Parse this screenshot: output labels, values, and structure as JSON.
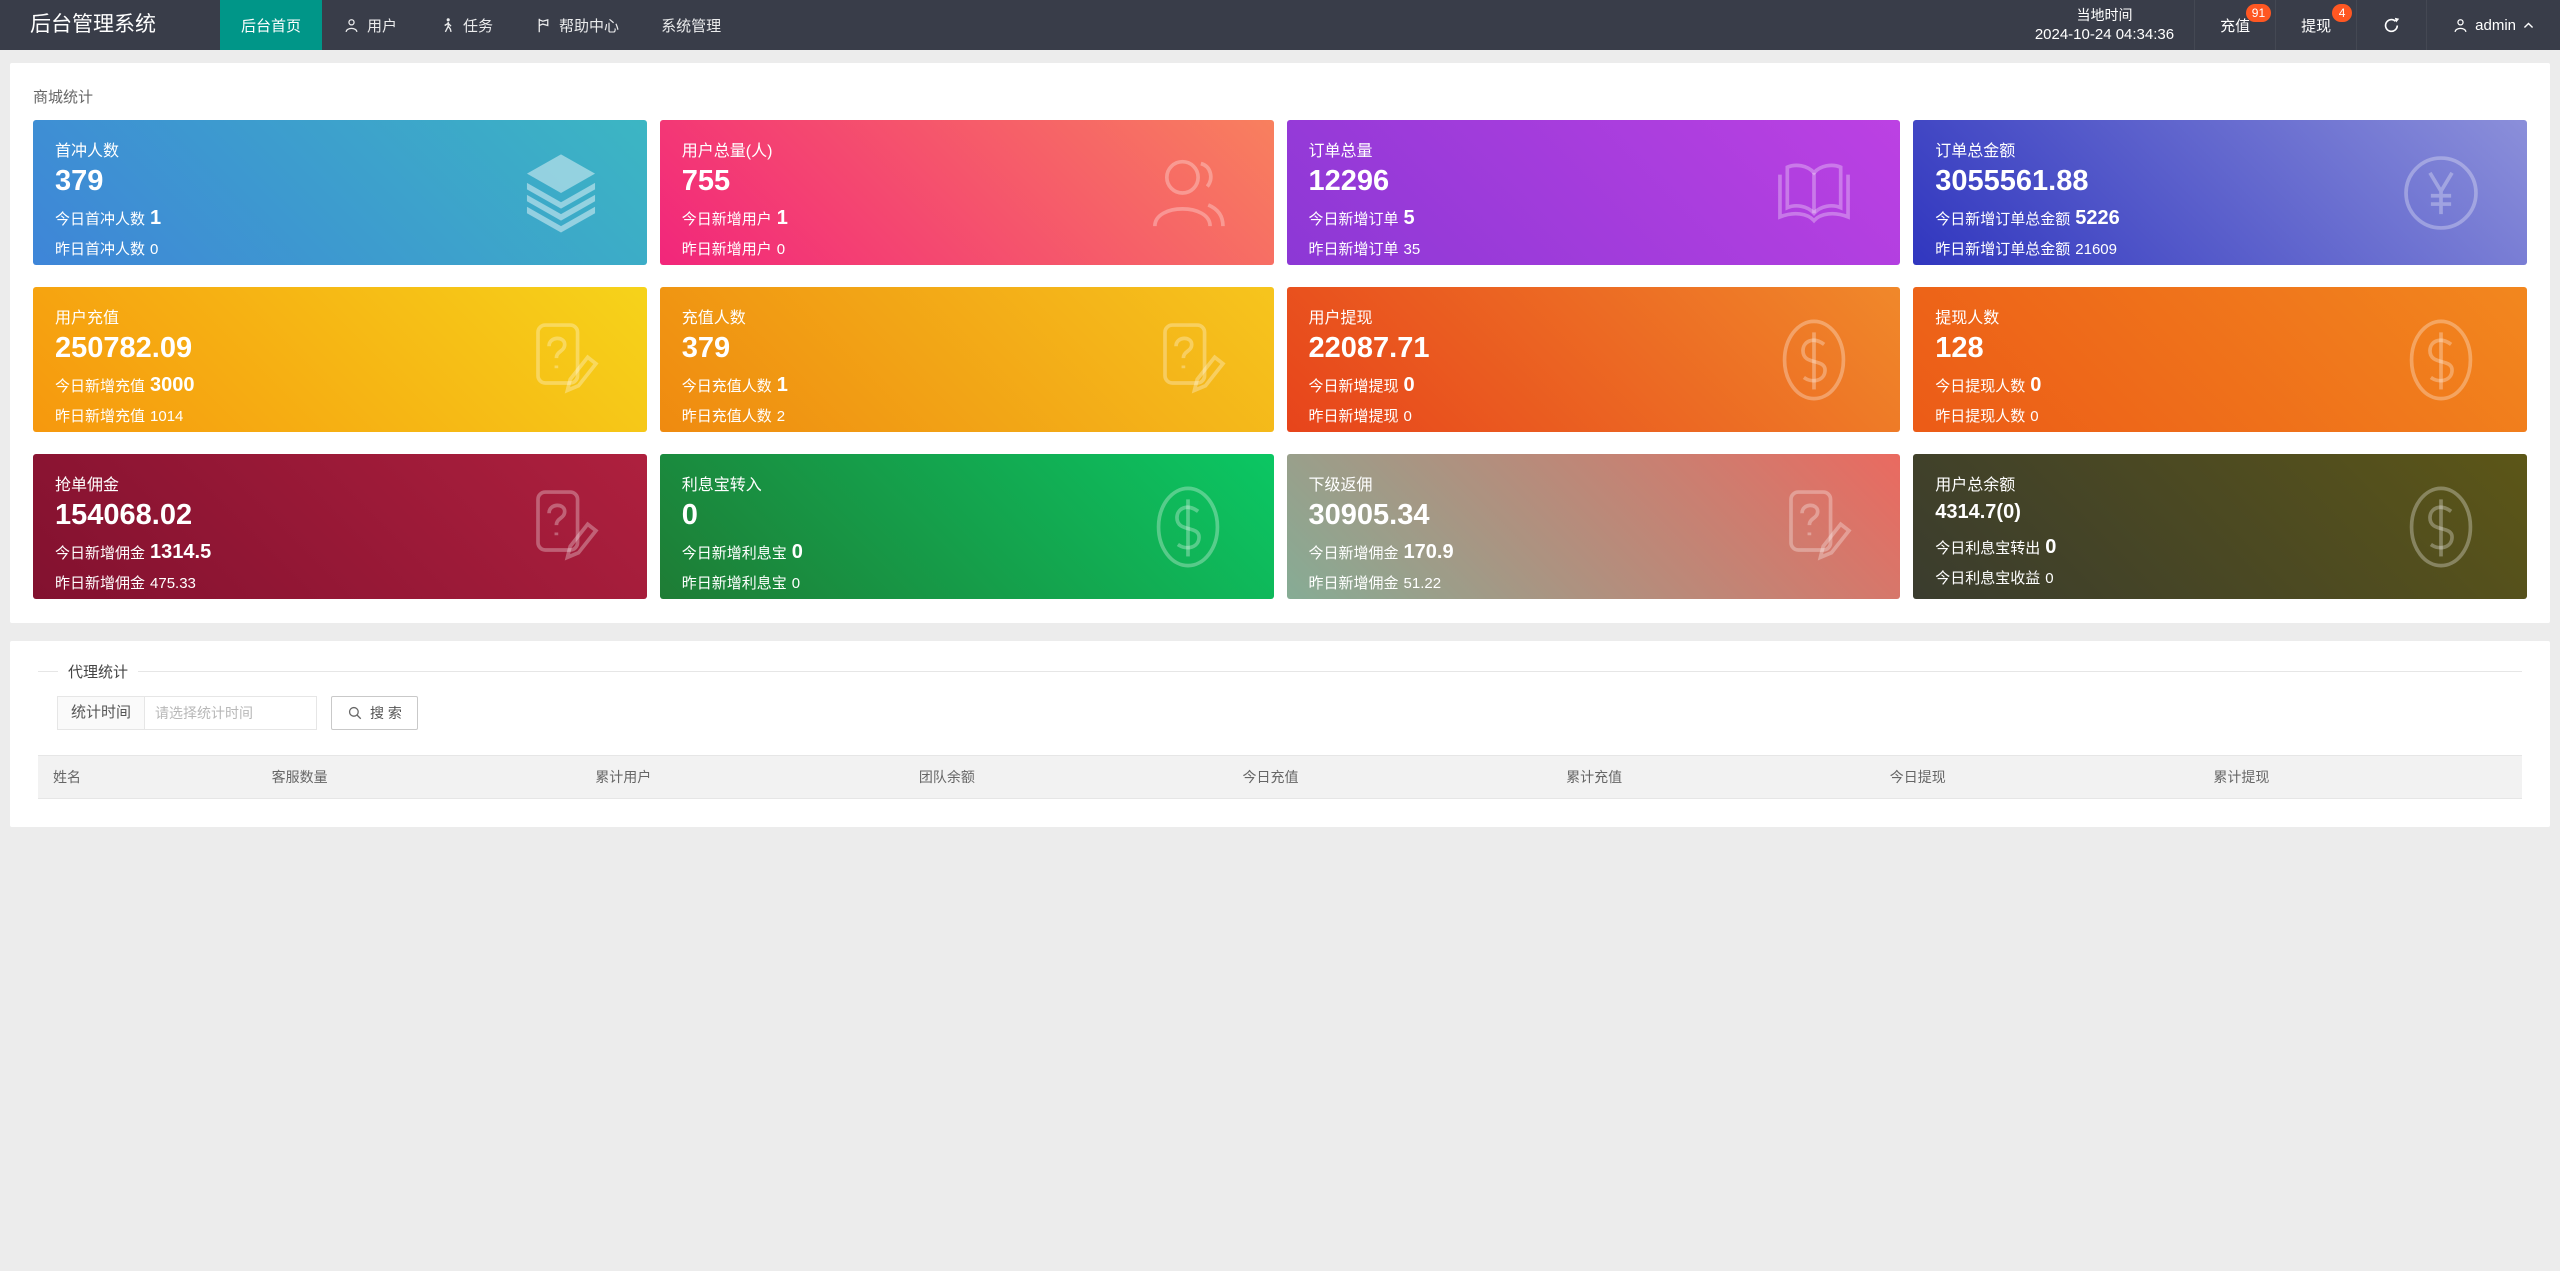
{
  "navbar": {
    "brand": "后台管理系统",
    "bar_color": "#393D49",
    "active_item_color": "#009688",
    "badge_color": "#FF5722",
    "items": [
      {
        "label": "后台首页",
        "active": true
      },
      {
        "label": "用户"
      },
      {
        "label": "任务"
      },
      {
        "label": "帮助中心"
      },
      {
        "label": "系统管理"
      }
    ],
    "local_time_label": "当地时间",
    "local_time_value": "2024-10-24 04:34:36",
    "recharge": {
      "label": "充值",
      "badge": "91"
    },
    "withdraw": {
      "label": "提现",
      "badge": "4"
    },
    "username": "admin"
  },
  "mall_stats": {
    "title": "商城统计",
    "cards": [
      {
        "title": "首冲人数",
        "value": "379",
        "today_label": "今日首冲人数",
        "today_value": "1",
        "yesterday_label": "昨日首冲人数",
        "yesterday_value": "0",
        "icon": "layers",
        "gradient": [
          "#3E85D8",
          "#3CB6C3"
        ]
      },
      {
        "title": "用户总量(人)",
        "value": "755",
        "today_label": "今日新增用户",
        "today_value": "1",
        "yesterday_label": "昨日新增用户",
        "yesterday_value": "0",
        "icon": "users",
        "gradient": [
          "#F2267B",
          "#F8805E"
        ]
      },
      {
        "title": "订单总量",
        "value": "12296",
        "today_label": "今日新增订单",
        "today_value": "5",
        "yesterday_label": "昨日新增订单",
        "yesterday_value": "35",
        "icon": "open-book",
        "gradient": [
          "#8C38D5",
          "#BC41E3"
        ]
      },
      {
        "title": "订单总金额",
        "value": "3055561.88",
        "today_label": "今日新增订单总金额",
        "today_value": "5226",
        "yesterday_label": "昨日新增订单总金额",
        "yesterday_value": "21609",
        "icon": "yen-circle",
        "gradient": [
          "#3036BF",
          "#8B8FDA"
        ]
      },
      {
        "title": "用户充值",
        "value": "250782.09",
        "today_label": "今日新增充值",
        "today_value": "3000",
        "yesterday_label": "昨日新增充值",
        "yesterday_value": "1014",
        "icon": "document-question",
        "gradient": [
          "#F6980E",
          "#F6D31A"
        ]
      },
      {
        "title": "充值人数",
        "value": "379",
        "today_label": "今日充值人数",
        "today_value": "1",
        "yesterday_label": "昨日充值人数",
        "yesterday_value": "2",
        "icon": "document-question",
        "gradient": [
          "#EF8A10",
          "#F6C51D"
        ]
      },
      {
        "title": "用户提现",
        "value": "22087.71",
        "today_label": "今日新增提现",
        "today_value": "0",
        "yesterday_label": "昨日新增提现",
        "yesterday_value": "0",
        "icon": "dollar-circle",
        "gradient": [
          "#E7441B",
          "#F0882A"
        ]
      },
      {
        "title": "提现人数",
        "value": "128",
        "today_label": "今日提现人数",
        "today_value": "0",
        "yesterday_label": "昨日提现人数",
        "yesterday_value": "0",
        "icon": "dollar-circle",
        "gradient": [
          "#EC5B17",
          "#F2871E"
        ]
      },
      {
        "title": "抢单佣金",
        "value": "154068.02",
        "today_label": "今日新增佣金",
        "today_value": "1314.5",
        "yesterday_label": "昨日新增佣金",
        "yesterday_value": "475.33",
        "icon": "document-question",
        "gradient": [
          "#82112F",
          "#AE203E"
        ]
      },
      {
        "title": "利息宝转入",
        "value": "0",
        "today_label": "今日新增利息宝",
        "today_value": "0",
        "yesterday_label": "昨日新增利息宝",
        "yesterday_value": "0",
        "icon": "dollar-circle",
        "gradient": [
          "#1E7C35",
          "#0BC763"
        ]
      },
      {
        "title": "下级返佣",
        "value": "30905.34",
        "today_label": "今日新增佣金",
        "today_value": "170.9",
        "yesterday_label": "昨日新增佣金",
        "yesterday_value": "51.22",
        "icon": "document-question",
        "gradient": [
          "#86AC95",
          "#EA6A60"
        ]
      },
      {
        "title": "用户总余额",
        "value": "4314.7(0)",
        "today_label": "今日利息宝转出",
        "today_value": "0",
        "yesterday_label": "今日利息宝收益",
        "yesterday_value": "0",
        "icon": "dollar-circle",
        "gradient": [
          "#3A3C2E",
          "#5C5617"
        ]
      }
    ]
  },
  "agent_stats": {
    "title": "代理统计",
    "filter_label": "统计时间",
    "filter_placeholder": "请选择统计时间",
    "search_label": "搜 索",
    "table_headers": [
      "姓名",
      "客服数量",
      "累计用户",
      "团队余额",
      "今日充值",
      "累计充值",
      "今日提现",
      "累计提现"
    ]
  }
}
